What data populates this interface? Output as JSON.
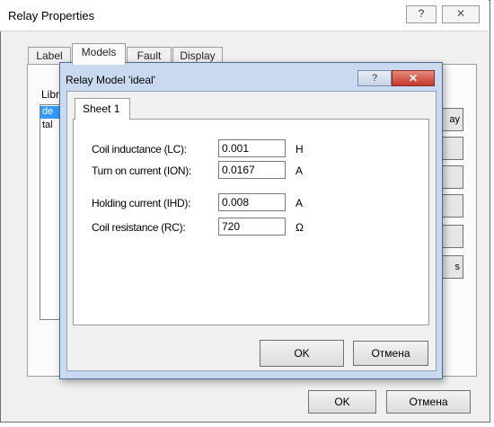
{
  "outer_window": {
    "title": "Relay Properties",
    "help_glyph": "?",
    "close_glyph": "✕",
    "tabs": [
      {
        "label": "Label"
      },
      {
        "label": "Models"
      },
      {
        "label": "Fault"
      },
      {
        "label": "Display"
      }
    ],
    "library_label": "Libr",
    "library_items": [
      "de",
      "tal"
    ],
    "side_buttons": [
      "ay",
      "",
      "",
      "",
      "",
      "s"
    ],
    "ok_label": "OK",
    "cancel_label": "Отмена"
  },
  "inner_dialog": {
    "title": "Relay Model 'ideal'",
    "help_glyph": "?",
    "close_glyph": "✕",
    "tab_label": "Sheet 1",
    "params": [
      {
        "label": "Coil inductance (LC):",
        "value": "0.001",
        "unit": "H"
      },
      {
        "label": "Turn on current (ION):",
        "value": "0.0167",
        "unit": "A"
      },
      {
        "label": "Holding current (IHD):",
        "value": "0.008",
        "unit": "A"
      },
      {
        "label": "Coil resistance (RC):",
        "value": "720",
        "unit": "Ω"
      }
    ],
    "ok_label": "OK",
    "cancel_label": "Отмена"
  },
  "colors": {
    "inner_frame": "#c9daf0",
    "close_button": "#c4382a",
    "selection": "#3399ff"
  }
}
